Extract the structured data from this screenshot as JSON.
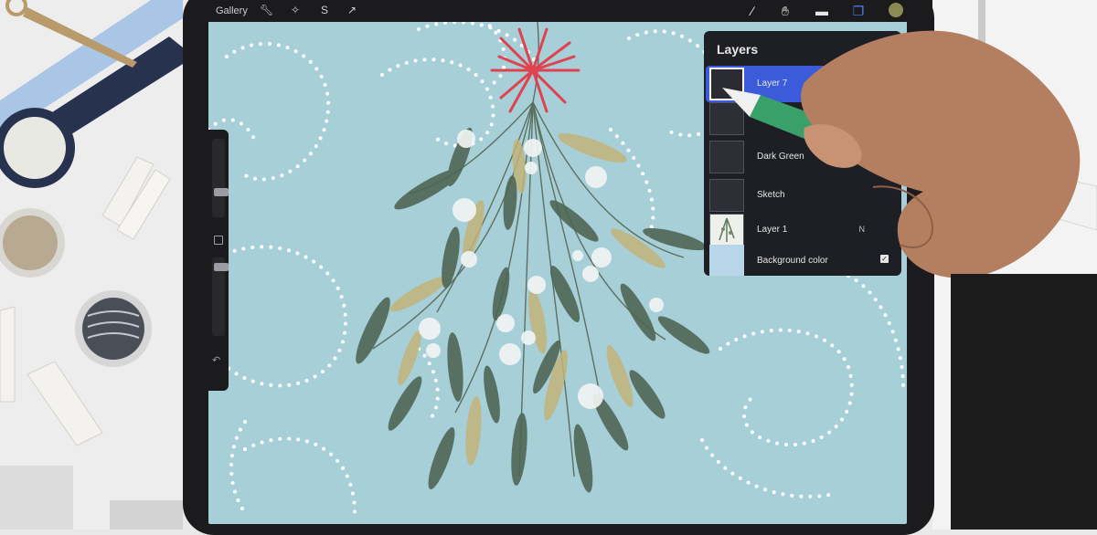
{
  "toolbar": {
    "gallery_label": "Gallery",
    "left_tools": [
      "wrench-icon",
      "magic-wand-icon",
      "selection-icon",
      "transform-icon"
    ],
    "right_tools": [
      "brush-icon",
      "smudge-icon",
      "eraser-icon",
      "layers-icon"
    ],
    "current_color": "#8a8a52"
  },
  "layers_panel": {
    "title": "Layers",
    "add_label": "+",
    "layers": [
      {
        "name": "Layer 7",
        "mode": "",
        "selected": true,
        "visible": true
      },
      {
        "name": "",
        "mode": "",
        "selected": false,
        "visible": true
      },
      {
        "name": "Dark Green",
        "mode": "",
        "selected": false,
        "visible": true
      },
      {
        "name": "Sketch",
        "mode": "",
        "selected": false,
        "visible": true
      },
      {
        "name": "Layer 1",
        "mode": "N",
        "selected": false,
        "visible": true
      },
      {
        "name": "Background color",
        "mode": "",
        "selected": false,
        "visible": true
      }
    ]
  },
  "canvas": {
    "background_color": "#a7cfd8",
    "ribbon_color": "#e0424f",
    "leaf_dark_color": "#4e6654",
    "leaf_gold_color": "#c2b37a",
    "berry_color": "#f1f4f3",
    "dot_color": "#ffffff"
  },
  "accent": "#3b5bdb"
}
